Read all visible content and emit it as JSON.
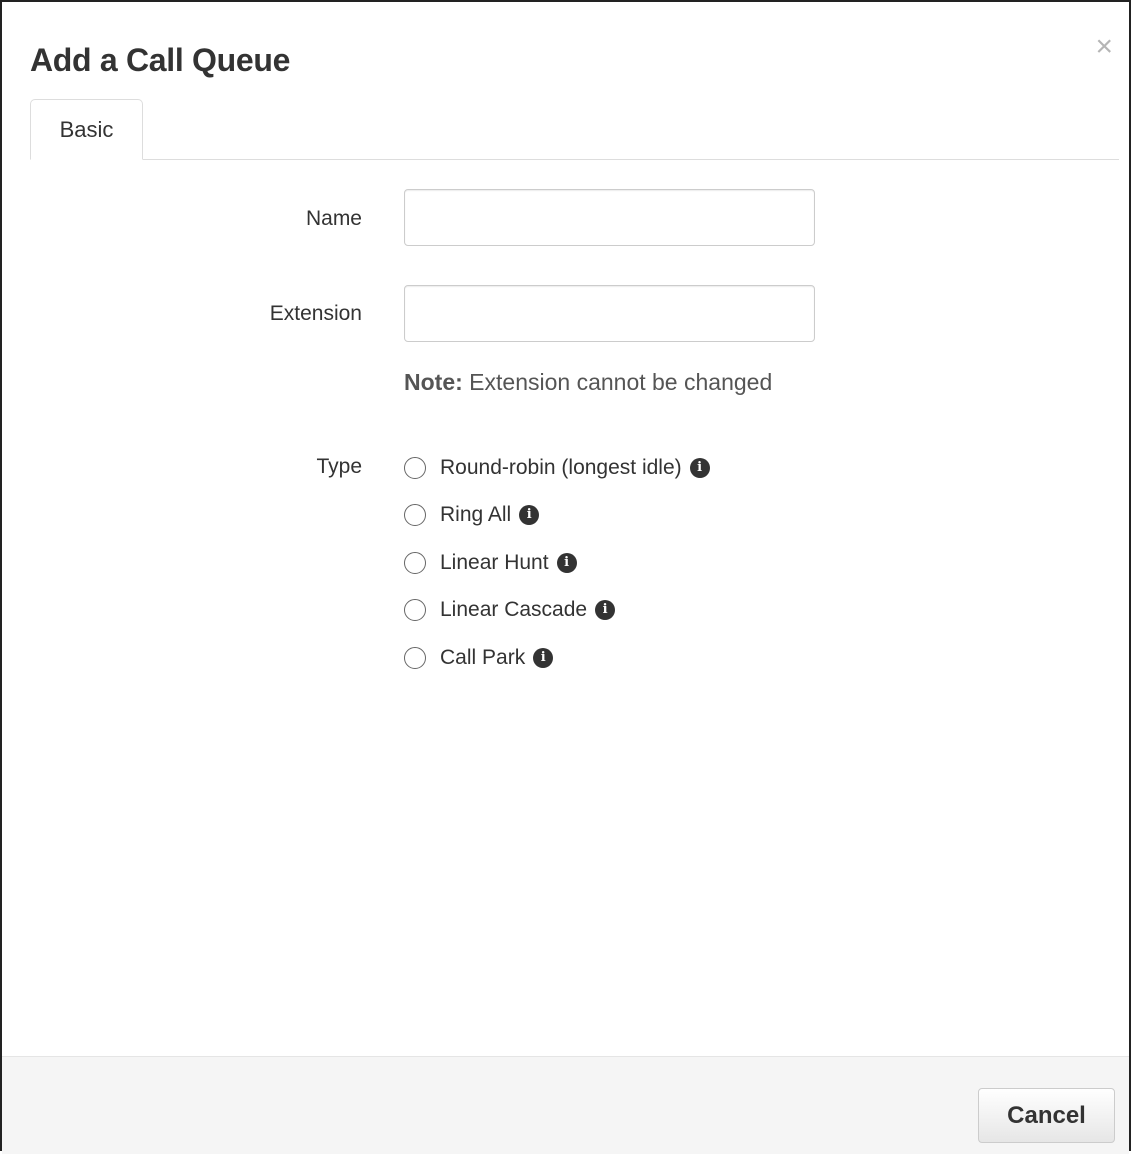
{
  "modal": {
    "title": "Add a Call Queue",
    "close_label": "×"
  },
  "tabs": [
    {
      "label": "Basic",
      "active": true
    }
  ],
  "form": {
    "name": {
      "label": "Name",
      "value": "",
      "placeholder": ""
    },
    "extension": {
      "label": "Extension",
      "value": "",
      "placeholder": ""
    },
    "note": {
      "prefix": "Note:",
      "text": " Extension cannot be changed"
    },
    "type": {
      "label": "Type",
      "options": [
        {
          "label": "Round-robin (longest idle)",
          "selected": false,
          "info_icon": "info-circle-icon"
        },
        {
          "label": "Ring All",
          "selected": false,
          "info_icon": "info-circle-icon"
        },
        {
          "label": "Linear Hunt",
          "selected": false,
          "info_icon": "info-circle-icon"
        },
        {
          "label": "Linear Cascade",
          "selected": false,
          "info_icon": "info-circle-icon"
        },
        {
          "label": "Call Park",
          "selected": false,
          "info_icon": "info-circle-icon"
        }
      ]
    }
  },
  "footer": {
    "cancel_label": "Cancel"
  }
}
